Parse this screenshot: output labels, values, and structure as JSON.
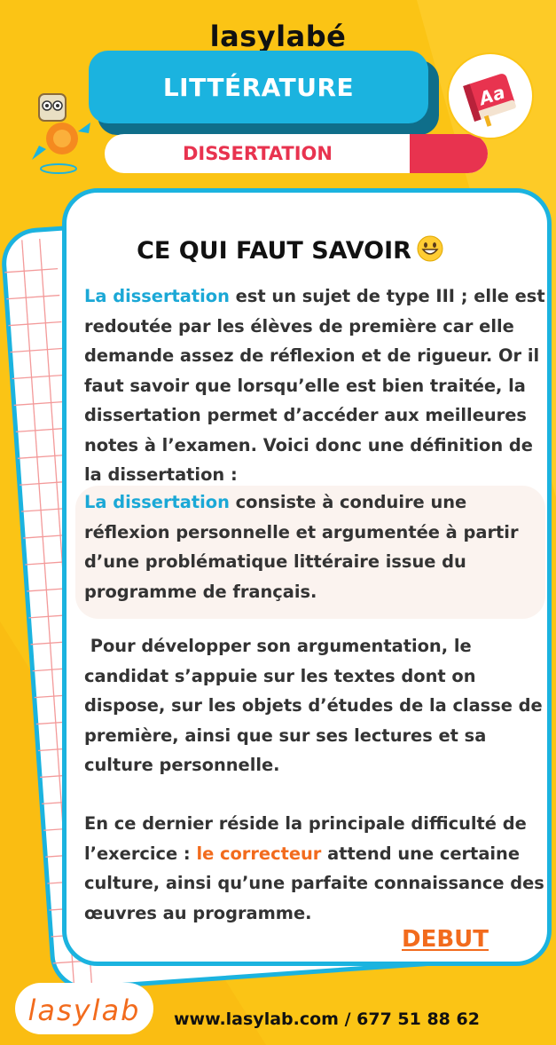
{
  "header": {
    "brand": "lasylabé",
    "subject": "LITTÉRATURE",
    "topic": "DISSERTATION"
  },
  "card": {
    "title": "CE QUI FAUT SAVOIR",
    "p1_highlight": "La dissertation",
    "p1_text": " est un sujet de type III ; elle est redoutée par les élèves de première car elle demande assez de réflexion et de rigueur. Or il faut savoir que lorsqu’elle est bien traitée, la dissertation permet d’accéder aux meilleures notes à l’examen. Voici donc une définition de la dissertation :",
    "p2_highlight": "La dissertation",
    "p2_text": " consiste à conduire une réflexion personnelle et argumentée à partir d’une problématique littéraire issue du programme de français.",
    "p3_text": " Pour développer son argumentation, le candidat s’appuie sur les textes dont on dispose, sur les objets d’études de la classe de première, ainsi que sur ses lectures et sa culture personnelle.",
    "p4_text_before": "En ce dernier réside la principale difficulté de l’exercice : ",
    "p4_highlight": "le correcteur",
    "p4_text_after": " attend une certaine culture, ainsi qu’une parfaite connaissance des œuvres au programme.",
    "cta": "DEBUT"
  },
  "footer": {
    "logo_text": "lasylab",
    "contact": "www.lasylab.com / 677 51 88 62"
  },
  "icons": {
    "book": "book-icon",
    "emoji": "grinning-face-icon",
    "mascot": "robot-mascot-icon"
  },
  "colors": {
    "background": "#FBC415",
    "accent_blue": "#1BB3DF",
    "accent_red": "#E8334F",
    "accent_orange": "#F26B1D"
  }
}
